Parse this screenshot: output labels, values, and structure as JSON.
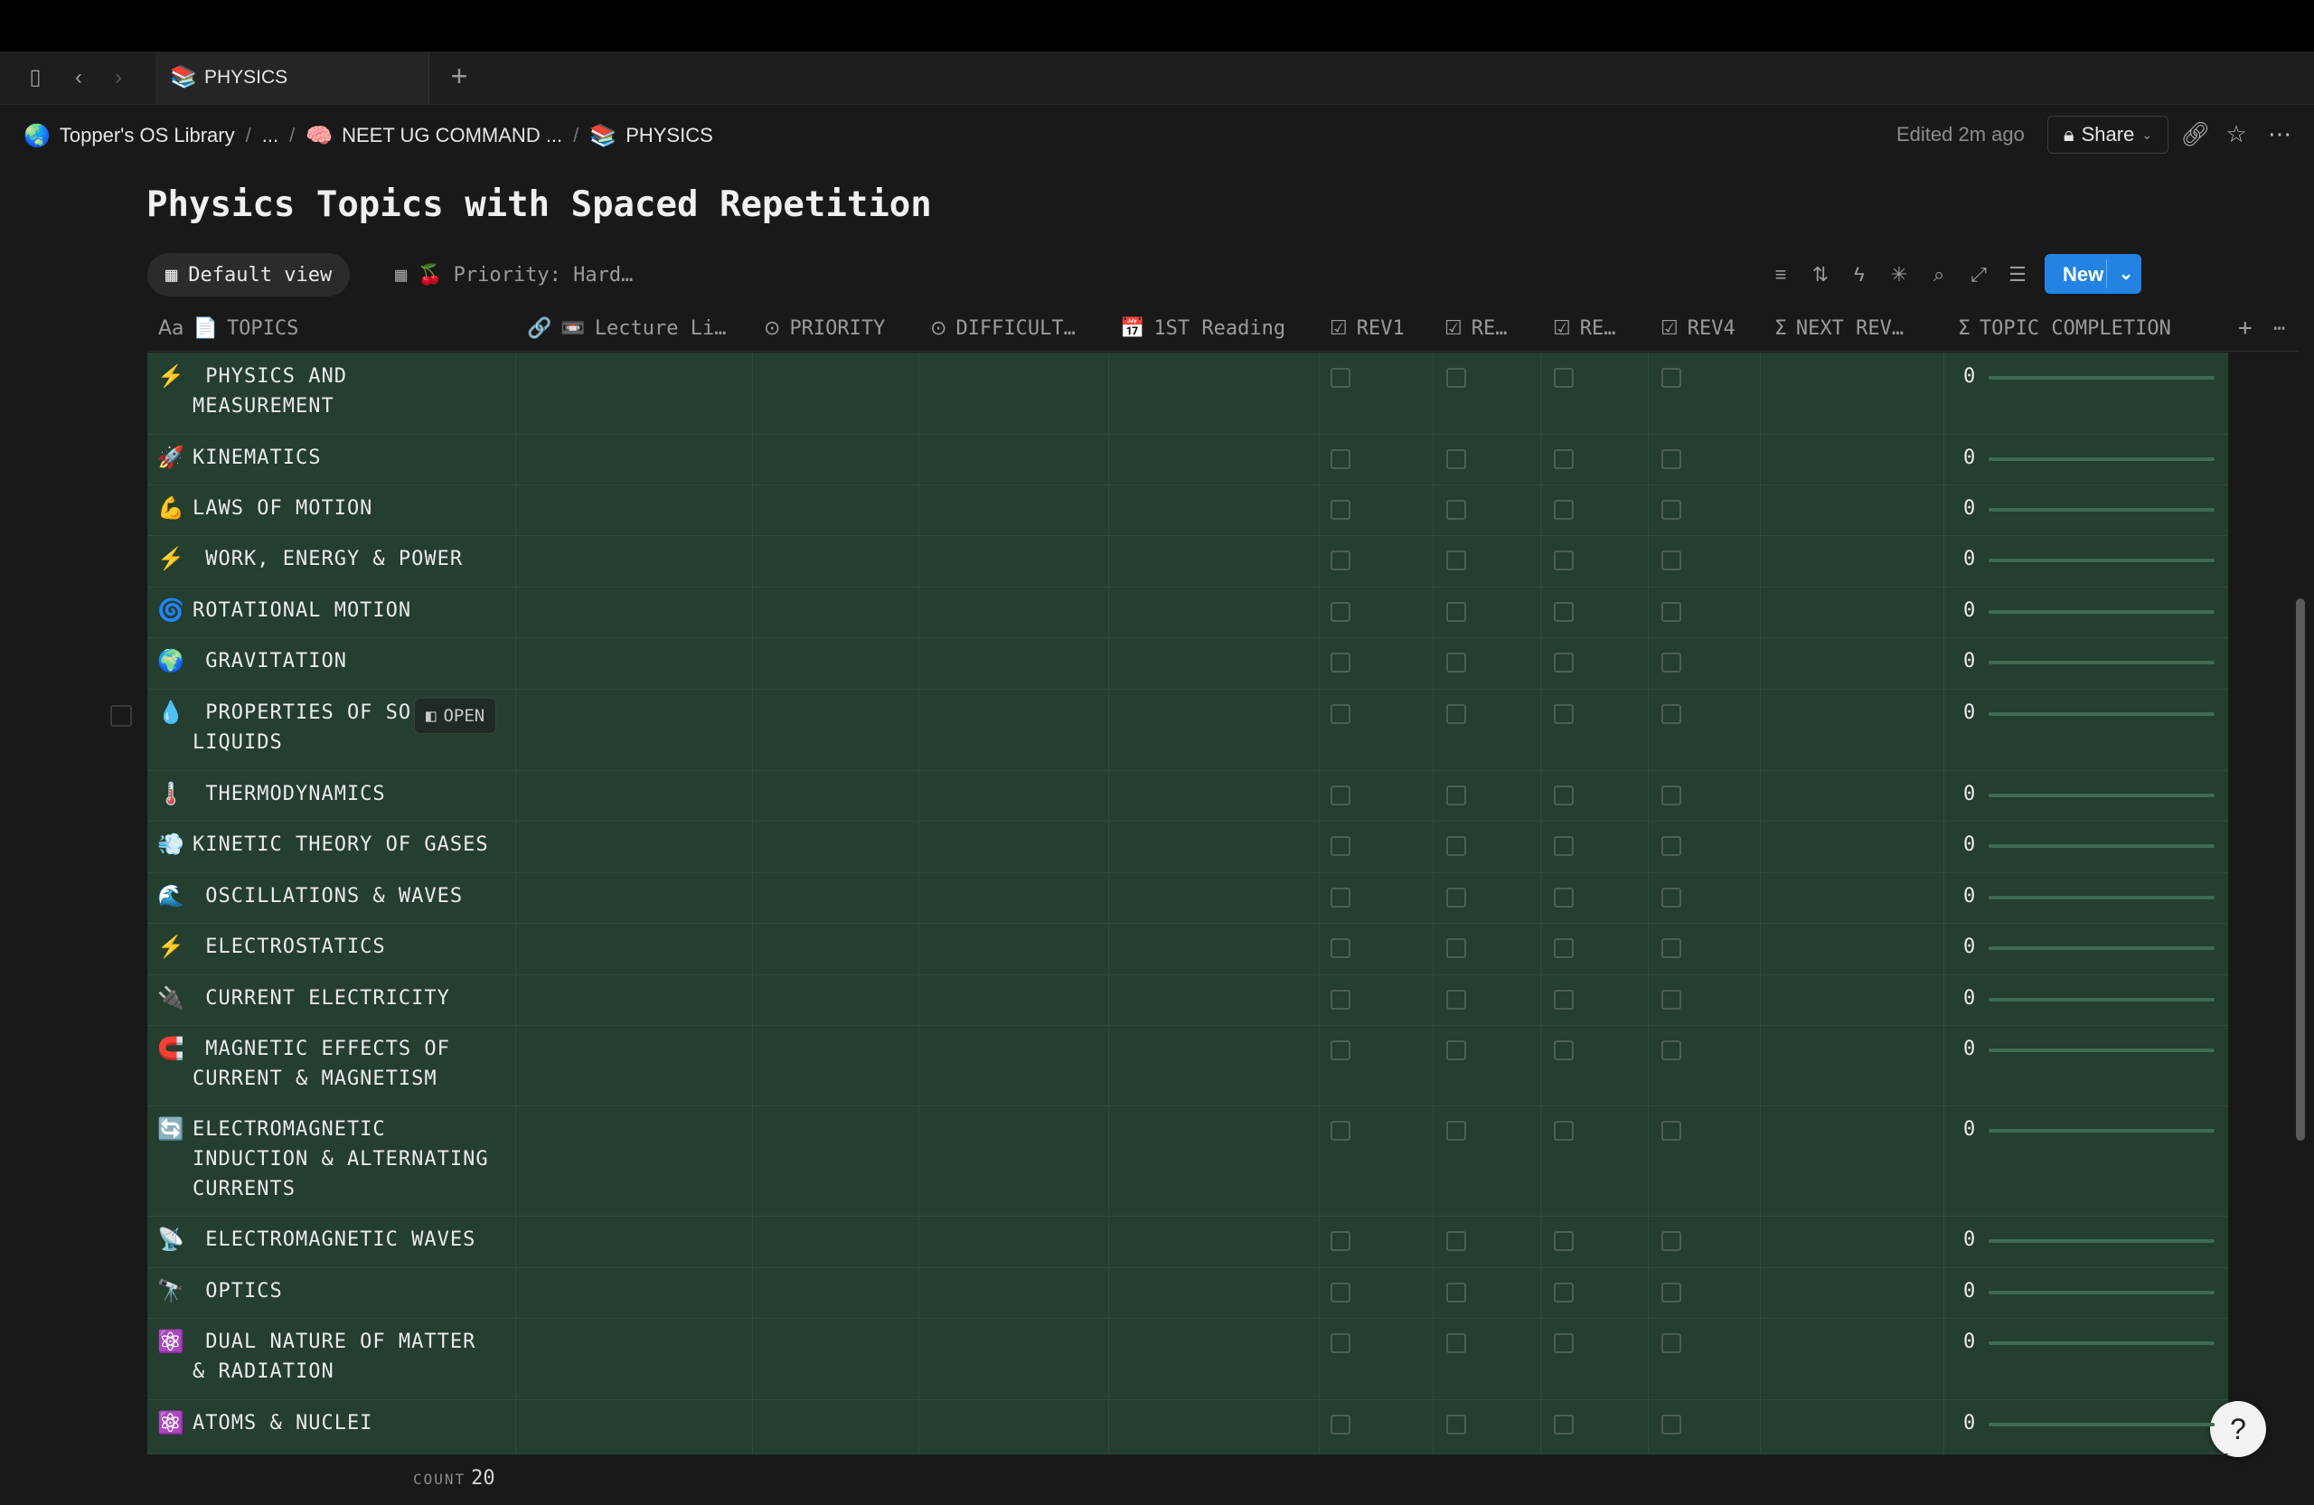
{
  "tab": {
    "title": "PHYSICS",
    "emoji": "📚"
  },
  "breadcrumb": [
    {
      "emoji": "🌏",
      "label": "Topper's OS Library"
    },
    {
      "label": "..."
    },
    {
      "emoji": "🧠",
      "label": "NEET UG COMMAND ..."
    },
    {
      "emoji": "📚",
      "label": "PHYSICS"
    }
  ],
  "header_right": {
    "edited": "Edited 2m ago",
    "share_label": "Share"
  },
  "page_title": "Physics Topics with Spaced Repetition",
  "views": {
    "default": "Default view",
    "priority": "Priority: Hard…",
    "priority_emoji": "🍒"
  },
  "new_button": "New",
  "columns": [
    {
      "icon": "Aa",
      "emoji": "📄",
      "label": "TOPICS"
    },
    {
      "icon": "🔗",
      "emoji": "📼",
      "label": "Lecture Li…"
    },
    {
      "icon": "⊙",
      "label": "PRIORITY"
    },
    {
      "icon": "⊙",
      "label": "DIFFICULT…"
    },
    {
      "icon": "📅",
      "label": "1ST Reading"
    },
    {
      "icon": "☑",
      "label": "REV1"
    },
    {
      "icon": "☑",
      "label": "RE…"
    },
    {
      "icon": "☑",
      "label": "RE…"
    },
    {
      "icon": "☑",
      "label": "REV4"
    },
    {
      "icon": "Σ",
      "label": "NEXT REV…"
    },
    {
      "icon": "Σ",
      "label": "TOPIC COMPLETION"
    }
  ],
  "rows": [
    {
      "emoji": "⚡",
      "line1": " PHYSICS AND",
      "line2": "MEASUREMENT",
      "completion": "0"
    },
    {
      "emoji": "🚀",
      "line1": "KINEMATICS",
      "completion": "0"
    },
    {
      "emoji": "💪",
      "line1": "LAWS OF MOTION",
      "completion": "0"
    },
    {
      "emoji": "⚡",
      "line1": " WORK, ENERGY & POWER",
      "completion": "0"
    },
    {
      "emoji": "🌀",
      "line1": "ROTATIONAL MOTION",
      "completion": "0"
    },
    {
      "emoji": "🌍",
      "line1": " GRAVITATION",
      "completion": "0"
    },
    {
      "emoji": "💧",
      "line1": " PROPERTIES OF SO",
      "line2": "LIQUIDS",
      "completion": "0"
    },
    {
      "emoji": "🌡️",
      "line1": " THERMODYNAMICS",
      "completion": "0"
    },
    {
      "emoji": "💨",
      "line1": "KINETIC THEORY OF GASES",
      "completion": "0"
    },
    {
      "emoji": "🌊",
      "line1": " OSCILLATIONS & WAVES",
      "completion": "0"
    },
    {
      "emoji": "⚡",
      "line1": " ELECTROSTATICS",
      "completion": "0"
    },
    {
      "emoji": "🔌",
      "line1": " CURRENT ELECTRICITY",
      "completion": "0"
    },
    {
      "emoji": "🧲",
      "line1": " MAGNETIC EFFECTS OF",
      "line2": "CURRENT & MAGNETISM",
      "completion": "0"
    },
    {
      "emoji": "🔄",
      "line1": "ELECTROMAGNETIC",
      "line2": "INDUCTION & ALTERNATING",
      "line3": "CURRENTS",
      "completion": "0"
    },
    {
      "emoji": "📡",
      "line1": " ELECTROMAGNETIC WAVES",
      "completion": "0"
    },
    {
      "emoji": "🔭",
      "line1": " OPTICS",
      "completion": "0"
    },
    {
      "emoji": "⚛️",
      "line1": " DUAL NATURE OF MATTER",
      "line2": "& RADIATION",
      "completion": "0"
    },
    {
      "emoji": "⚛️",
      "line1": "ATOMS & NUCLEI",
      "completion": "0"
    }
  ],
  "open_badge": "OPEN",
  "footer": {
    "count_label": "COUNT",
    "count_value": "20"
  },
  "colors": {
    "table_bg": "#243e30",
    "accent": "#2383e2"
  }
}
